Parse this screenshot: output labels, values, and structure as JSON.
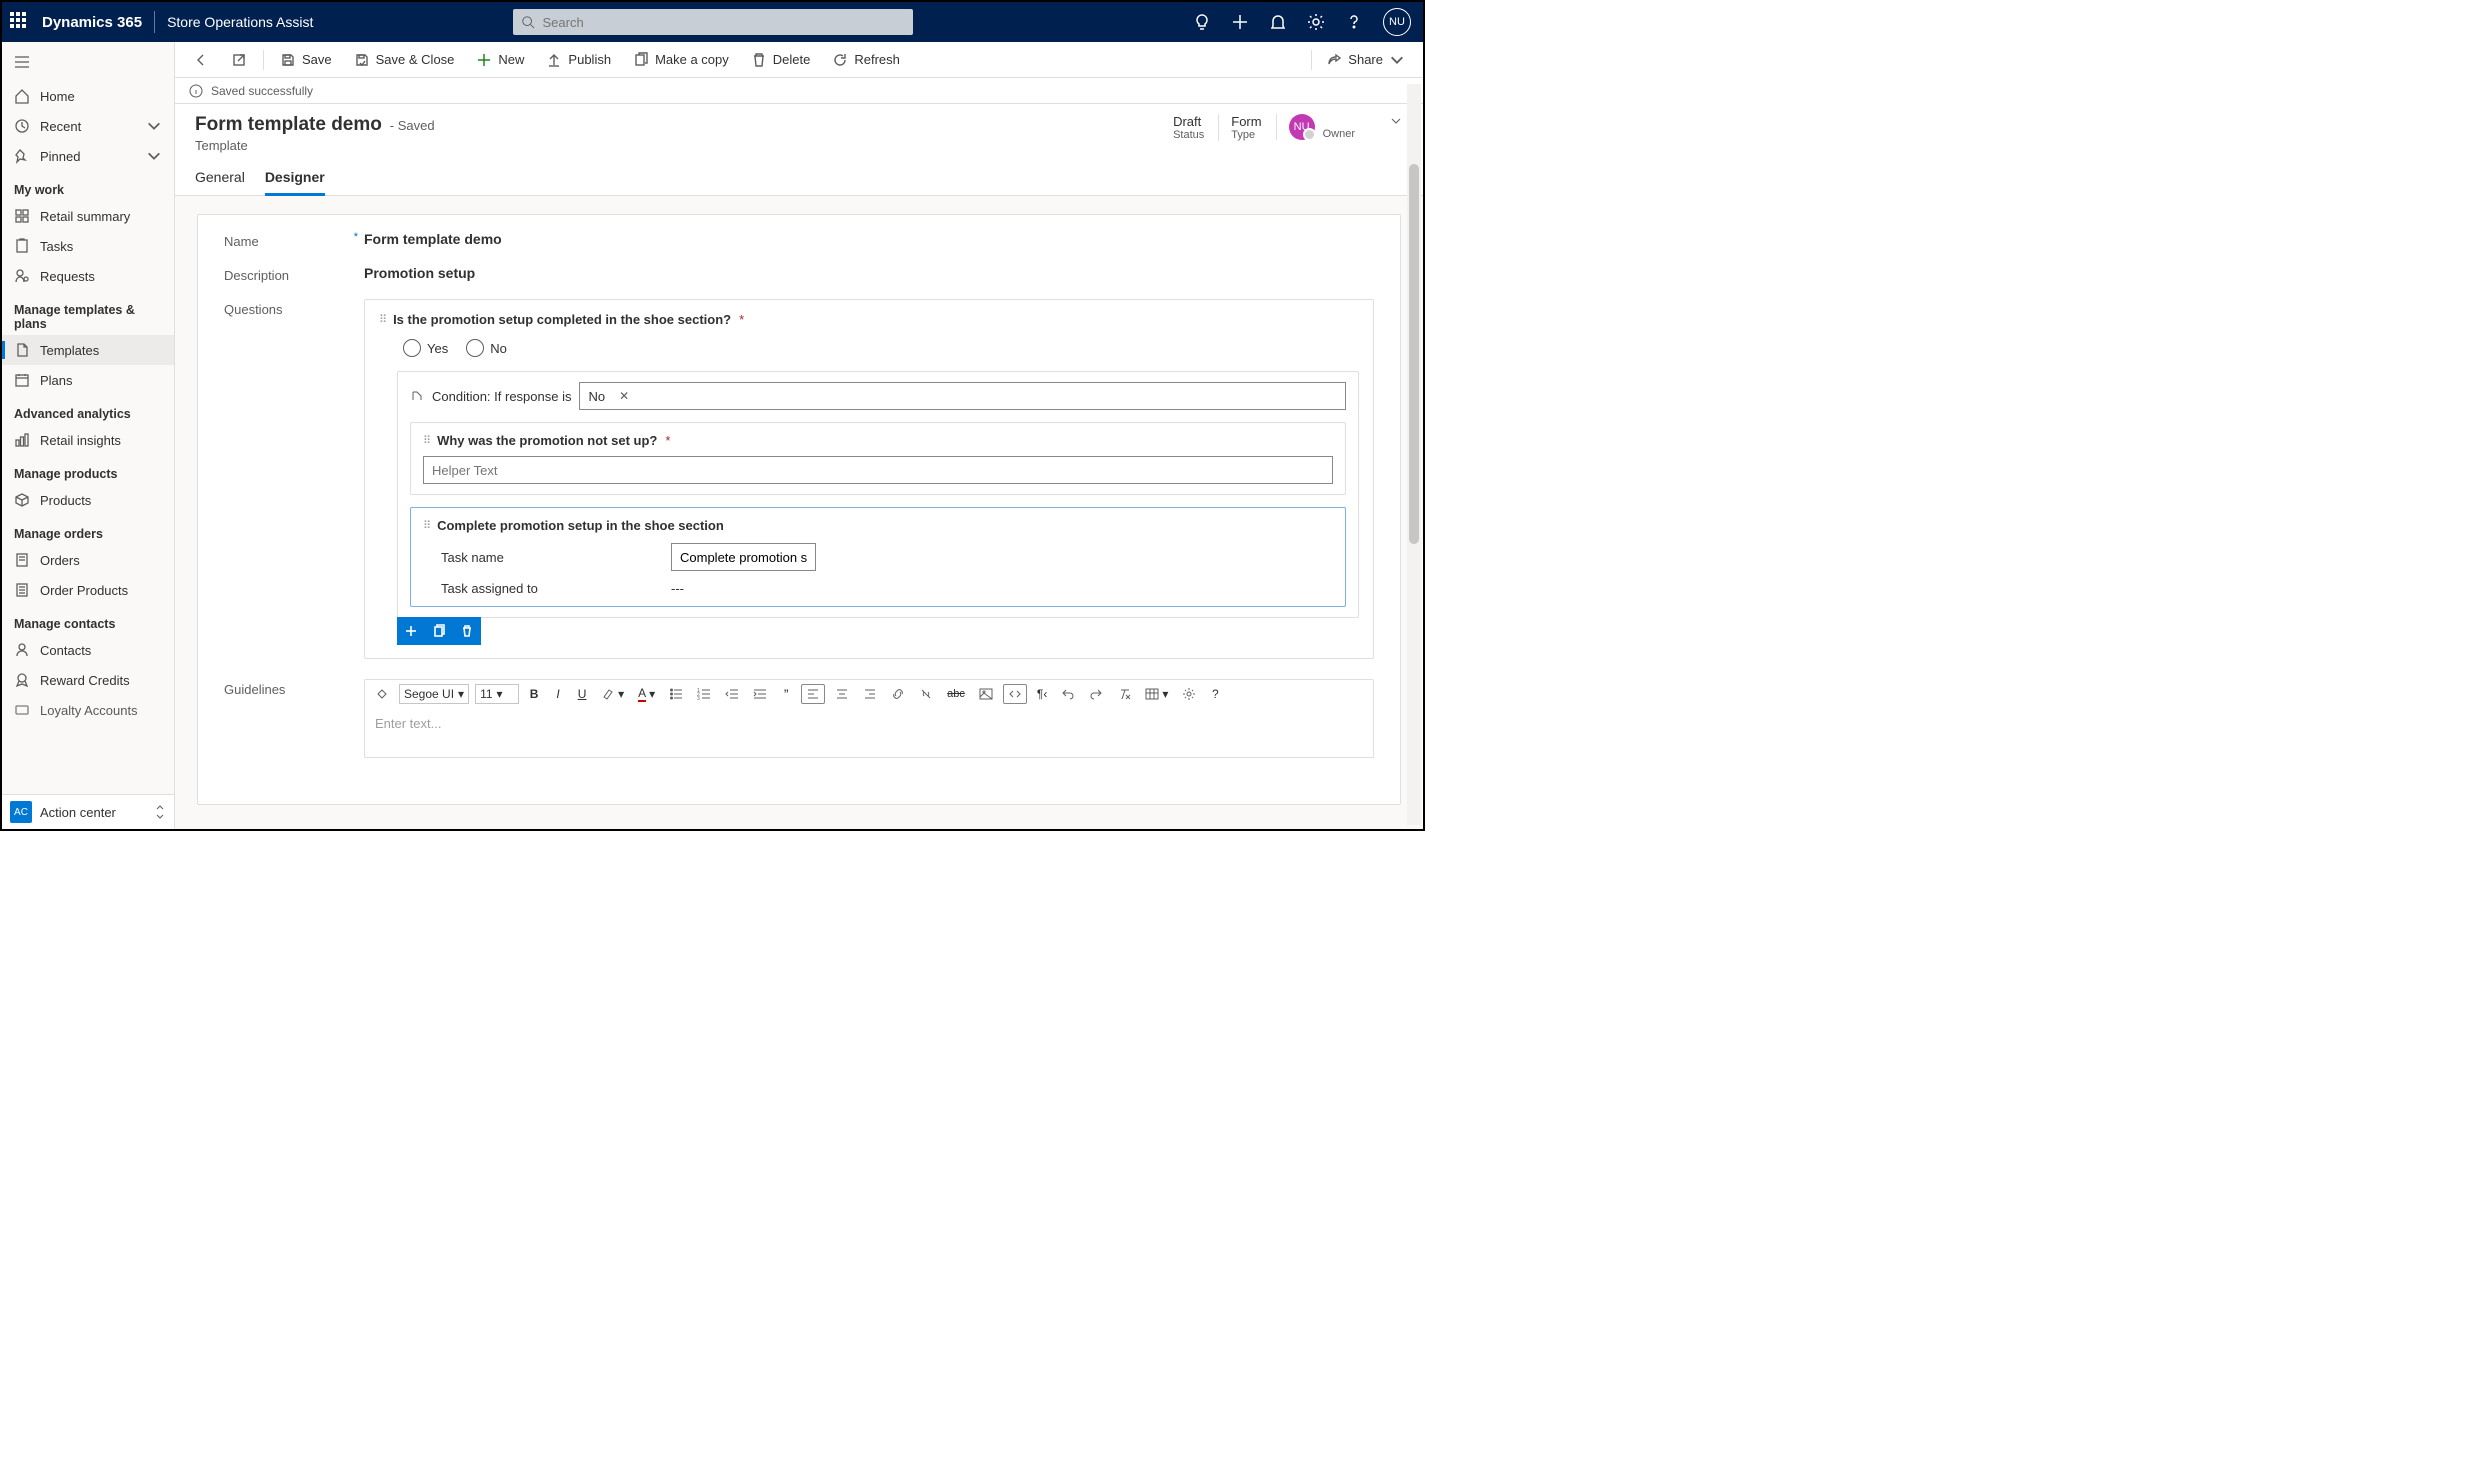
{
  "topbar": {
    "brand": "Dynamics 365",
    "appname": "Store Operations Assist",
    "search_placeholder": "Search",
    "avatar_initials": "NU"
  },
  "sidebar": {
    "home": "Home",
    "recent": "Recent",
    "pinned": "Pinned",
    "group_mywork": "My work",
    "retail_summary": "Retail summary",
    "tasks": "Tasks",
    "requests": "Requests",
    "group_templates": "Manage templates & plans",
    "templates": "Templates",
    "plans": "Plans",
    "group_analytics": "Advanced analytics",
    "retail_insights": "Retail insights",
    "group_products": "Manage products",
    "products": "Products",
    "group_orders": "Manage orders",
    "orders": "Orders",
    "order_products": "Order Products",
    "group_contacts": "Manage contacts",
    "contacts": "Contacts",
    "reward_credits": "Reward Credits",
    "loyalty_accounts": "Loyalty Accounts",
    "action_center_badge": "AC",
    "action_center": "Action center"
  },
  "cmdbar": {
    "save": "Save",
    "save_close": "Save & Close",
    "new": "New",
    "publish": "Publish",
    "make_copy": "Make a copy",
    "delete": "Delete",
    "refresh": "Refresh",
    "share": "Share"
  },
  "savedbar": {
    "text": "Saved successfully"
  },
  "header": {
    "title": "Form template demo",
    "suffix": "- Saved",
    "subtitle": "Template",
    "status_v": "Draft",
    "status_l": "Status",
    "type_v": "Form",
    "type_l": "Type",
    "owner_initials": "NU",
    "owner_l": "Owner"
  },
  "tabs": {
    "general": "General",
    "designer": "Designer"
  },
  "form": {
    "name_label": "Name",
    "name_value": "Form template demo",
    "desc_label": "Description",
    "desc_value": "Promotion setup",
    "questions_label": "Questions",
    "q1_text": "Is the promotion setup completed in the shoe section?",
    "yes": "Yes",
    "no": "No",
    "cond_label": "Condition: If response is",
    "cond_value": "No",
    "q2_text": "Why was the promotion not set up?",
    "helper_placeholder": "Helper Text",
    "q3_text": "Complete promotion setup in the shoe section",
    "task_name_label": "Task name",
    "task_name_value": "Complete promotion s...",
    "task_assigned_label": "Task assigned to",
    "task_assigned_value": "---",
    "guidelines_label": "Guidelines",
    "guide_font": "Segoe UI",
    "guide_size": "11",
    "guide_placeholder": "Enter text..."
  }
}
